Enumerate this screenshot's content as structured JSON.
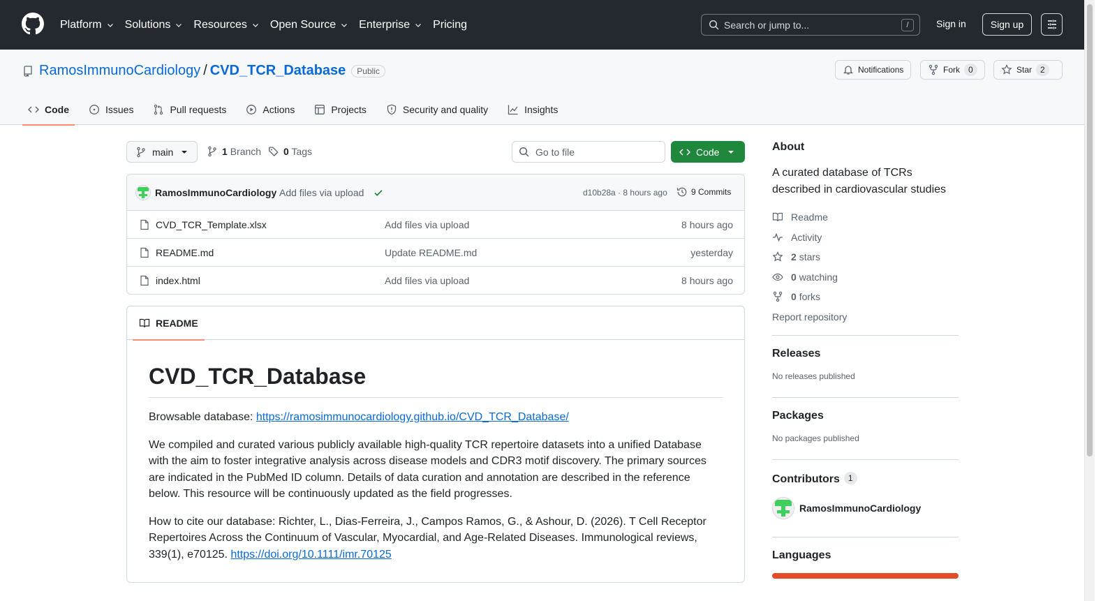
{
  "header": {
    "nav": [
      "Platform",
      "Solutions",
      "Resources",
      "Open Source",
      "Enterprise",
      "Pricing"
    ],
    "search_placeholder": "Search or jump to...",
    "search_shortcut": "/",
    "signin": "Sign in",
    "signup": "Sign up"
  },
  "repo": {
    "owner": "RamosImmunoCardiology",
    "separator": "/",
    "name": "CVD_TCR_Database",
    "visibility": "Public",
    "notifications": "Notifications",
    "fork_label": "Fork",
    "fork_count": "0",
    "star_label": "Star",
    "star_count": "2"
  },
  "tabs": [
    "Code",
    "Issues",
    "Pull requests",
    "Actions",
    "Projects",
    "Security and quality",
    "Insights"
  ],
  "toolbar": {
    "branch": "main",
    "branch_count": "1",
    "branch_label": "Branch",
    "tag_count": "0",
    "tag_label": "Tags",
    "goto_placeholder": "Go to file",
    "code_button": "Code"
  },
  "commit": {
    "author": "RamosImmunoCardiology",
    "message": "Add files via upload",
    "sha_time": "d10b28a · 8 hours ago",
    "commits": "9 Commits"
  },
  "files": [
    {
      "name": "CVD_TCR_Template.xlsx",
      "message": "Add files via upload",
      "date": "8 hours ago"
    },
    {
      "name": "README.md",
      "message": "Update README.md",
      "date": "yesterday"
    },
    {
      "name": "index.html",
      "message": "Add files via upload",
      "date": "8 hours ago"
    }
  ],
  "readme": {
    "tab": "README",
    "title": "CVD_TCR_Database",
    "browsable_prefix": "Browsable database: ",
    "browsable_link": "https://ramosimmunocardiology.github.io/CVD_TCR_Database/",
    "paragraph": "We compiled and curated various publicly available high-quality TCR repertoire datasets into a unified Database with the aim to foster integrative analysis across disease models and CDR3 motif discovery. The primary sources are indicated in the PubMed ID column. Details of data curation and annotation are described in the reference below. This resource will be continuously updated as the field progresses.",
    "cite_text": "How to cite our database: Richter, L., Dias-Ferreira, J., Campos Ramos, G., & Ashour, D. (2026). T Cell Receptor Repertoires Across the Continuum of Vascular, Myocardial, and Age-Related Diseases. Immunological reviews, 339(1), e70125. ",
    "cite_link": "https://doi.org/10.1111/imr.70125"
  },
  "sidebar": {
    "about_title": "About",
    "about_desc": "A curated database of TCRs described in cardiovascular studies",
    "readme_link": "Readme",
    "activity_link": "Activity",
    "stars_count": "2",
    "stars_label": "stars",
    "watching_count": "0",
    "watching_label": "watching",
    "forks_count": "0",
    "forks_label": "forks",
    "report": "Report repository",
    "releases_title": "Releases",
    "releases_empty": "No releases published",
    "packages_title": "Packages",
    "packages_empty": "No packages published",
    "contributors_title": "Contributors",
    "contributors_count": "1",
    "contributor_name": "RamosImmunoCardiology",
    "languages_title": "Languages"
  },
  "colors": {
    "header_bg": "#24292f",
    "link_blue": "#0969da",
    "primary_green": "#1f883d",
    "tab_underline": "#fd8c73",
    "language_html": "#e34c26"
  }
}
